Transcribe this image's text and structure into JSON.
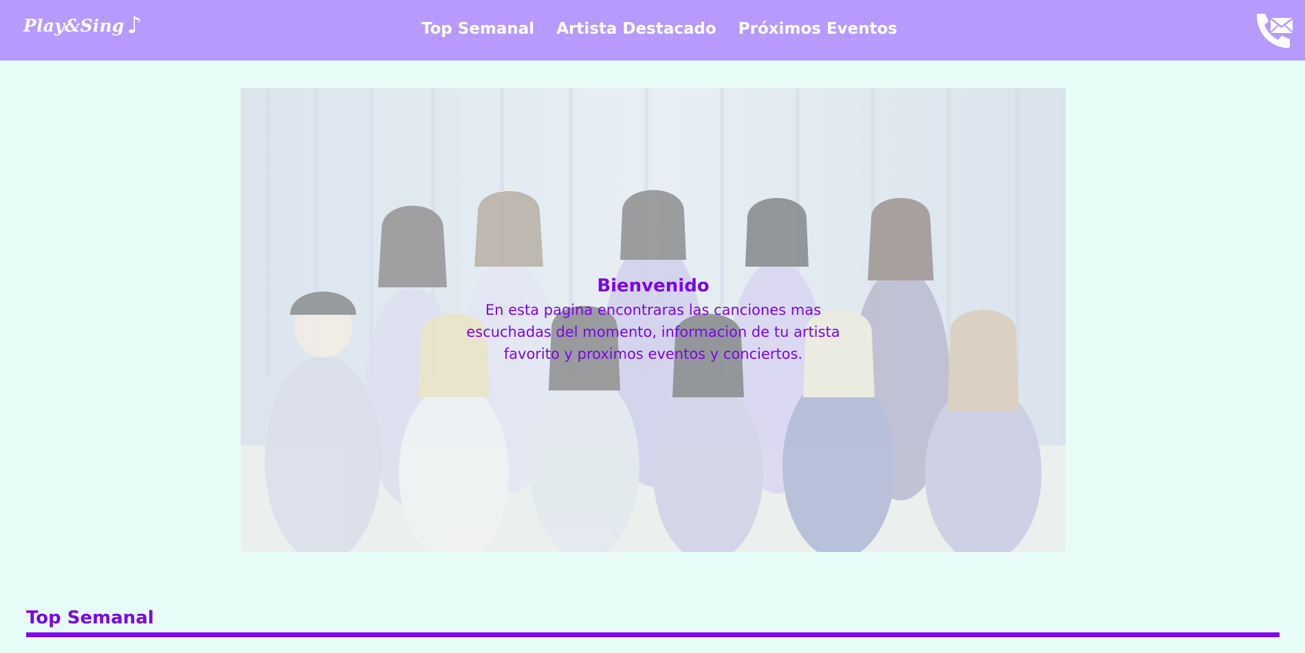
{
  "header": {
    "logo": "Play&Sing",
    "logo_glyph": "♪",
    "nav": [
      {
        "label": "Top Semanal"
      },
      {
        "label": "Artista Destacado"
      },
      {
        "label": "Próximos Eventos"
      }
    ],
    "contact_icon": "phone-mail-icon"
  },
  "hero": {
    "title": "Bienvenido",
    "body": "En esta pagina encontraras las canciones mas escuchadas del momento, informacion de tu artista favorito y proximos eventos y conciertos."
  },
  "section": {
    "title": "Top Semanal"
  },
  "colors": {
    "header_bg": "#b899fe",
    "page_bg": "#e8fdf8",
    "accent": "#7b06e8",
    "header_text": "#ffffff"
  }
}
